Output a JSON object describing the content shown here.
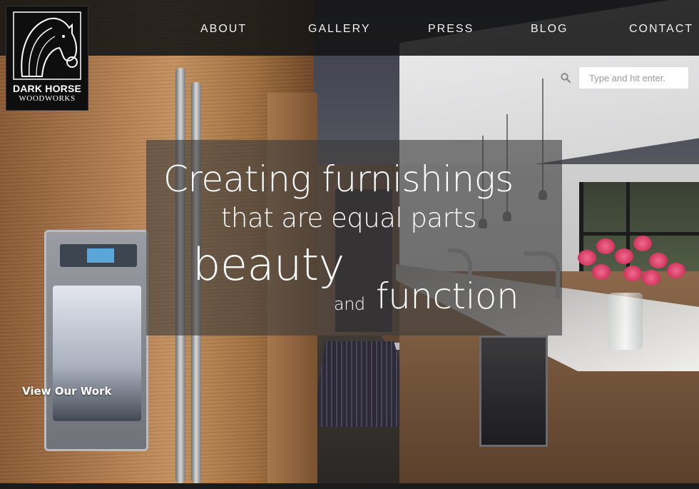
{
  "brand": {
    "line1": "DARK HORSE",
    "line2": "WOODWORKS"
  },
  "nav": {
    "about": "ABOUT",
    "gallery": "GALLERY",
    "press": "PRESS",
    "blog": "BLOG",
    "contact": "CONTACT"
  },
  "search": {
    "placeholder": "Type and hit enter.",
    "value": "",
    "icon": "search-icon"
  },
  "hero": {
    "line1": "Creating furnishings",
    "line2": "that are equal parts",
    "line3": "beauty",
    "line4": "and",
    "line5": "function",
    "cta": "View Our Work"
  },
  "colors": {
    "header_bg": "#141414",
    "text": "#ffffff",
    "overlay": "#3c3c3c"
  }
}
